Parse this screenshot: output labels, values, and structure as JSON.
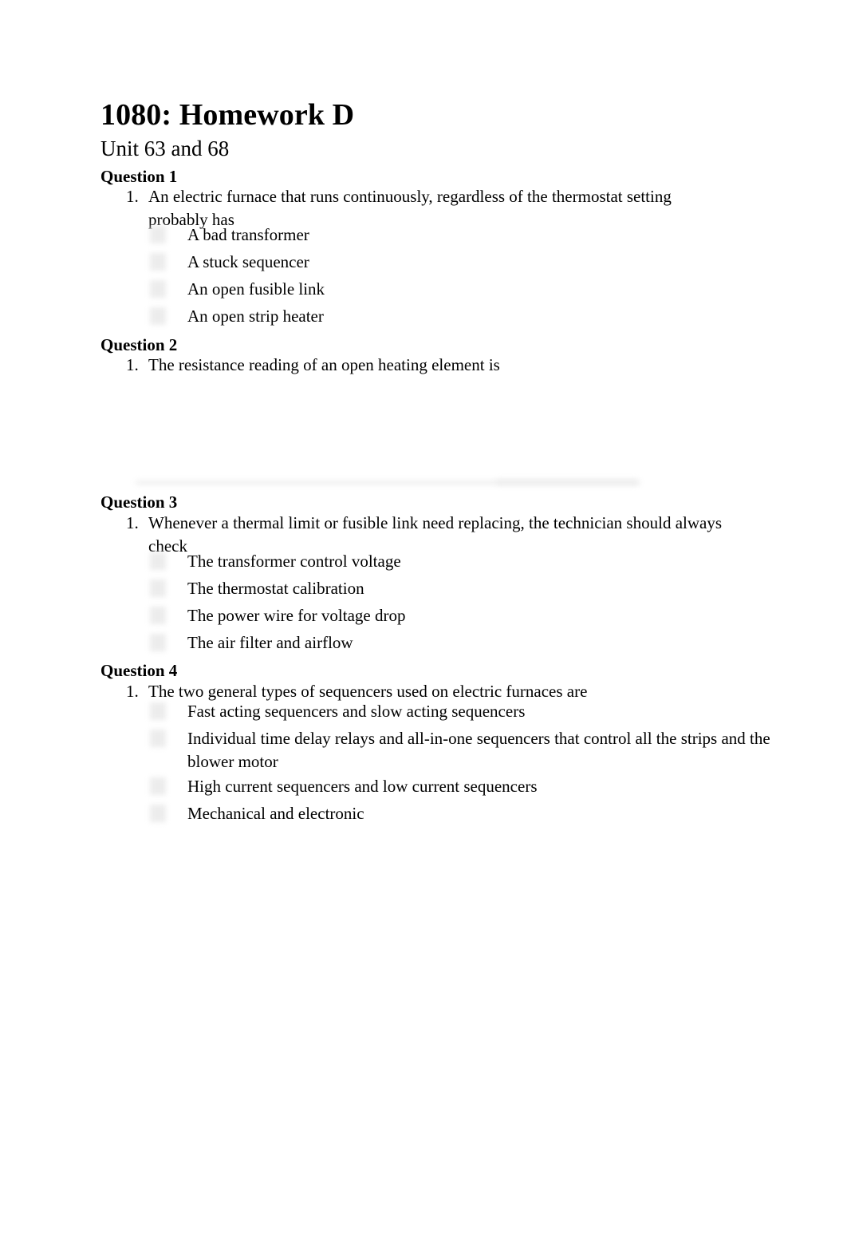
{
  "document": {
    "title": "1080: Homework D",
    "subtitle": "Unit 63 and 68"
  },
  "questions": [
    {
      "heading": "Question 1",
      "number": "1.",
      "prompt": "An electric furnace that runs continuously, regardless of the thermostat setting probably has",
      "options": [
        "A bad transformer",
        "A stuck sequencer",
        "An open fusible link",
        "An open strip heater"
      ]
    },
    {
      "heading": "Question 2",
      "number": "1.",
      "prompt": "The resistance reading of an open heating element is",
      "options": []
    },
    {
      "heading": "Question 3",
      "number": "1.",
      "prompt": "Whenever a thermal limit or fusible link need replacing, the technician should always check",
      "options": [
        "The transformer control voltage",
        "The thermostat calibration",
        "The power wire for voltage drop",
        "The air filter and airflow"
      ]
    },
    {
      "heading": "Question 4",
      "number": "1.",
      "prompt": "The two general types of sequencers used on electric furnaces are",
      "options": [
        "Fast acting sequencers and slow acting sequencers",
        "Individual time delay relays and all-in-one sequencers that control all the strips and the blower motor",
        "High current sequencers and low current sequencers",
        "Mechanical and electronic"
      ]
    }
  ],
  "colors": {
    "page_background": "#ffffff",
    "text": "#000000",
    "placeholder_grey": "#e9e9e9"
  }
}
